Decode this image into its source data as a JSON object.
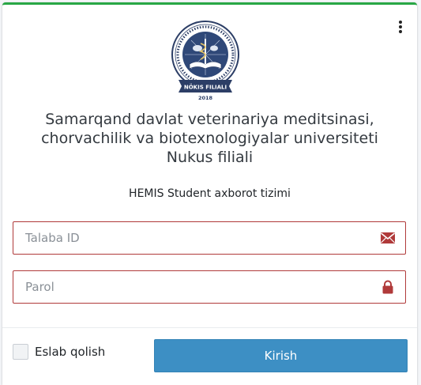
{
  "header": {
    "menu_icon": "more-vertical-icon",
    "logo_icon": "university-emblem-logo"
  },
  "logo": {
    "ribbon_text": "NÖKIS FILIALI",
    "year": "2018"
  },
  "title": "Samarqand davlat veterinariya meditsinasi,\nchorvachilik va biotexnologiyalar universiteti\nNukus filiali",
  "subtitle": "HEMIS Student axborot tizimi",
  "form": {
    "student_id": {
      "value": "",
      "placeholder": "Talaba ID",
      "icon": "envelope-icon"
    },
    "password": {
      "value": "",
      "placeholder": "Parol",
      "icon": "lock-icon"
    },
    "remember_label": "Eslab qolish",
    "remember_checked": false,
    "submit_label": "Kirish"
  },
  "colors": {
    "top_border": "#28a745",
    "field_border": "#b03a3a",
    "icon": "#b03a3a",
    "button": "#3d8fc4"
  }
}
